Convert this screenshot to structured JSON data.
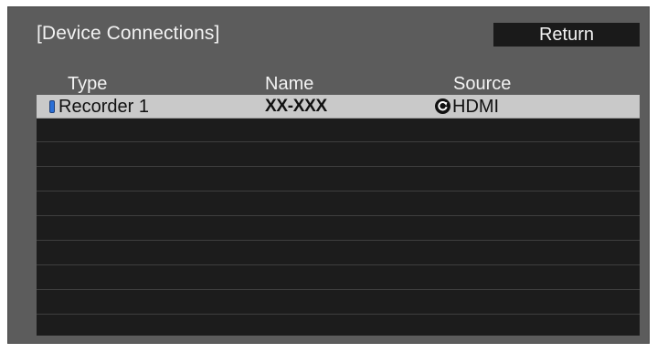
{
  "dialog": {
    "title": "[Device Connections]",
    "return_label": "Return"
  },
  "table": {
    "columns": [
      "Type",
      "Name",
      "Source"
    ],
    "rows": [
      {
        "type": "Recorder 1",
        "name": "XX-XXX",
        "source": "HDMI",
        "selected": true,
        "type_icon": "recorder-device-icon",
        "source_icon": "link-arrow-icon"
      }
    ],
    "empty_rows": 9
  },
  "colors": {
    "panel_bg": "#5c5c5c",
    "table_bg": "#1c1c1c",
    "selected_row_bg": "#c9c9c9",
    "return_button_bg": "#1a1a1a",
    "device_icon": "#2a6fd6"
  }
}
